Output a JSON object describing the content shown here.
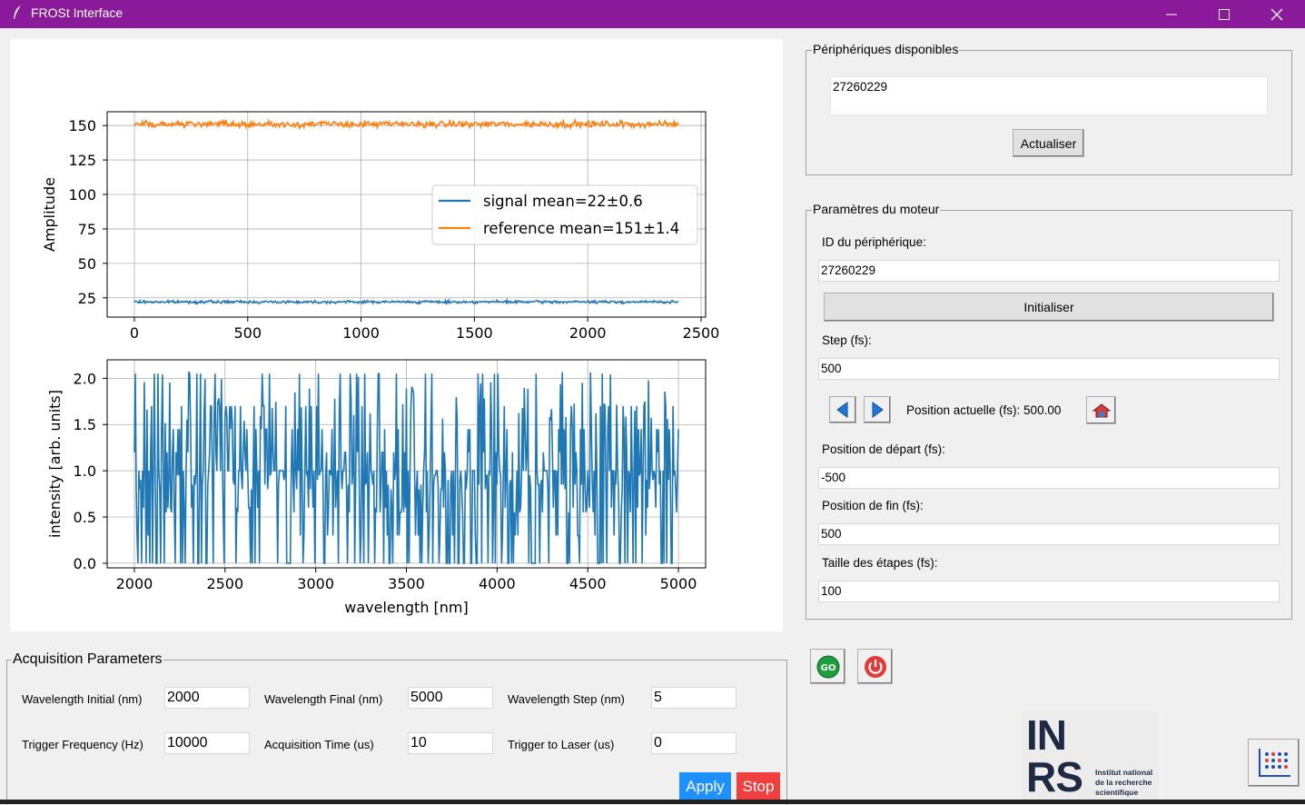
{
  "window": {
    "title": "FROSt Interface"
  },
  "chart_data": [
    {
      "type": "line",
      "title": "",
      "xlabel": "",
      "ylabel": "Amplitude",
      "xlim": [
        -120,
        2520
      ],
      "ylim": [
        11,
        160
      ],
      "xticks": [
        0,
        500,
        1000,
        1500,
        2000,
        2500
      ],
      "yticks": [
        25,
        50,
        75,
        100,
        125,
        150
      ],
      "grid": true,
      "legend_position": "center-right",
      "series": [
        {
          "name": "signal mean=22±0.6",
          "color": "#1f77b4",
          "x_range": [
            0,
            2400
          ],
          "mean": 22,
          "std": 0.6
        },
        {
          "name": "reference mean=151±1.4",
          "color": "#ff7f0e",
          "x_range": [
            0,
            2400
          ],
          "mean": 151,
          "std": 1.4
        }
      ]
    },
    {
      "type": "line",
      "title": "",
      "xlabel": "wavelength [nm]",
      "ylabel": "intensity [arb. units]",
      "xlim": [
        1850,
        5150
      ],
      "ylim": [
        -0.05,
        2.2
      ],
      "xticks": [
        2000,
        2500,
        3000,
        3500,
        4000,
        4500,
        5000
      ],
      "yticks": [
        "0.0",
        "0.5",
        "1.0",
        "1.5",
        "2.0"
      ],
      "grid": true,
      "series": [
        {
          "color": "#1f77b4",
          "x_range": [
            2000,
            5000
          ],
          "x_step": 5,
          "y_range": [
            0.0,
            2.1
          ]
        }
      ]
    }
  ],
  "devices": {
    "title": "Périphériques disponibles",
    "list_value": "27260229",
    "refresh_label": "Actualiser"
  },
  "motor": {
    "title": "Paramètres du moteur",
    "device_id_label": "ID du périphérique:",
    "device_id_value": "27260229",
    "init_label": "Initialiser",
    "step_label": "Step (fs):",
    "step_value": "500",
    "position_text": "Position actuelle (fs): 500.00",
    "start_label": "Position de départ (fs):",
    "start_value": "-500",
    "end_label": "Position de fin (fs):",
    "end_value": "500",
    "stepsize_label": "Taille des étapes (fs):",
    "stepsize_value": "100"
  },
  "actions": {
    "go_label": "GO"
  },
  "acquisition": {
    "title": "Acquisition Parameters",
    "wl_initial_label": "Wavelength Initial (nm)",
    "wl_initial_value": "2000",
    "wl_final_label": "Wavelength Final (nm)",
    "wl_final_value": "5000",
    "wl_step_label": "Wavelength Step (nm)",
    "wl_step_value": "5",
    "trig_freq_label": "Trigger Frequency (Hz)",
    "trig_freq_value": "10000",
    "acq_time_label": "Acquisition Time (us)",
    "acq_time_value": "10",
    "trig_laser_label": "Trigger to Laser (us)",
    "trig_laser_value": "0",
    "apply_label": "Apply",
    "stop_label": "Stop"
  },
  "logo": {
    "text_in": "IN",
    "text_rs": "RS",
    "caption_line1": "Institut national",
    "caption_line2": "de la recherche",
    "caption_line3": "scientifique"
  },
  "colors": {
    "titlebar": "#8b1a9a",
    "apply": "#1e90ff",
    "stop": "#ef3f3f",
    "go": "#1e9e3e",
    "power": "#e23b3b",
    "arrow": "#1f77d4"
  }
}
